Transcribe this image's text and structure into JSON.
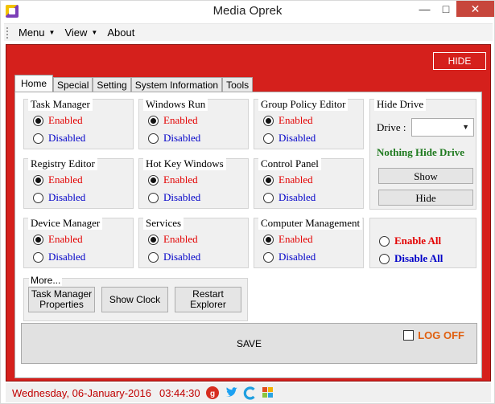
{
  "window": {
    "title": "Media Oprek",
    "minimize": "—",
    "maximize": "□",
    "close": "✕"
  },
  "menu": [
    {
      "label": "Menu",
      "caret": "▼"
    },
    {
      "label": "View",
      "caret": "▼"
    },
    {
      "label": "About",
      "caret": ""
    }
  ],
  "hide_top": "HIDE",
  "tabs": [
    "Home",
    "Special",
    "Setting",
    "System Information",
    "Tools"
  ],
  "groups": {
    "task_manager": {
      "title": "Task Manager",
      "enabled": "Enabled",
      "disabled": "Disabled"
    },
    "windows_run": {
      "title": "Windows Run",
      "enabled": "Enabled",
      "disabled": "Disabled"
    },
    "group_policy": {
      "title": "Group Policy Editor",
      "enabled": "Enabled",
      "disabled": "Disabled"
    },
    "registry": {
      "title": "Registry Editor",
      "enabled": "Enabled",
      "disabled": "Disabled"
    },
    "hotkey": {
      "title": "Hot Key Windows",
      "enabled": "Enabled",
      "disabled": "Disabled"
    },
    "control_panel": {
      "title": "Control Panel",
      "enabled": "Enabled",
      "disabled": "Disabled"
    },
    "device_manager": {
      "title": "Device Manager",
      "enabled": "Enabled",
      "disabled": "Disabled"
    },
    "services": {
      "title": "Services",
      "enabled": "Enabled",
      "disabled": "Disabled"
    },
    "computer_mgmt": {
      "title": "Computer Management",
      "enabled": "Enabled",
      "disabled": "Disabled"
    }
  },
  "hide_drive": {
    "title": "Hide Drive",
    "drive_label": "Drive :",
    "drive_value": "",
    "status": "Nothing Hide Drive",
    "show_button": "Show",
    "hide_button": "Hide"
  },
  "all": {
    "enable_all": "Enable All",
    "disable_all": "Disable All"
  },
  "more": {
    "title": "More...",
    "task_manager_props": "Task Manager Properties",
    "show_clock": "Show Clock",
    "restart_explorer": "Restart Explorer"
  },
  "save": {
    "label": "SAVE",
    "logoff": "LOG OFF"
  },
  "status": {
    "date": "Wednesday, 06-January-2016",
    "time": "03:44:30",
    "icons": [
      "google-plus-icon",
      "twitter-icon",
      "c-logo-icon",
      "squares-icon"
    ]
  }
}
